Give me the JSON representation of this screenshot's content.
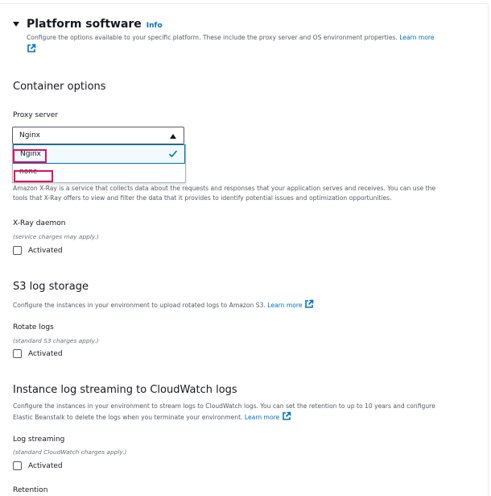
{
  "platform": {
    "title": "Platform software",
    "info_label": "Info",
    "description": "Configure the options available to your specific platform. These include the proxy server and OS environment properties.",
    "learn_more": "Learn more"
  },
  "container": {
    "title": "Container options",
    "proxy_label": "Proxy server",
    "selected_value": "Nginx",
    "options": [
      "Nginx",
      "none"
    ]
  },
  "xray": {
    "description_line1": "Amazon X-Ray is a service that collects data about the requests and responses that your application serves and receives. You can use the",
    "description_line2": "tools that X-Ray offers to view and filter the data that it provides to identify potential issues and optimization opportunities.",
    "label": "X-Ray daemon",
    "hint": "(service charges may apply.)",
    "checkbox_label": "Activated"
  },
  "s3": {
    "title": "S3 log storage",
    "description": "Configure the instances in your environment to upload rotated logs to Amazon S3.",
    "learn_more": "Learn more",
    "label": "Rotate logs",
    "hint": "(standard S3 charges apply.)",
    "checkbox_label": "Activated"
  },
  "cloudwatch": {
    "title": "Instance log streaming to CloudWatch logs",
    "description_line1": "Configure the instances in your environment to stream logs to CloudWatch logs. You can set the retention to up to 10 years and configure",
    "description_line2": "Elastic Beanstalk to delete the logs when you terminate your environment.",
    "learn_more": "Learn more",
    "label": "Log streaming",
    "hint": "(standard CloudWatch charges apply.)",
    "checkbox_label": "Activated",
    "retention_label": "Retention"
  },
  "colors": {
    "link": "#0073bb",
    "highlight": "#e0115f",
    "text": "#16191f"
  }
}
